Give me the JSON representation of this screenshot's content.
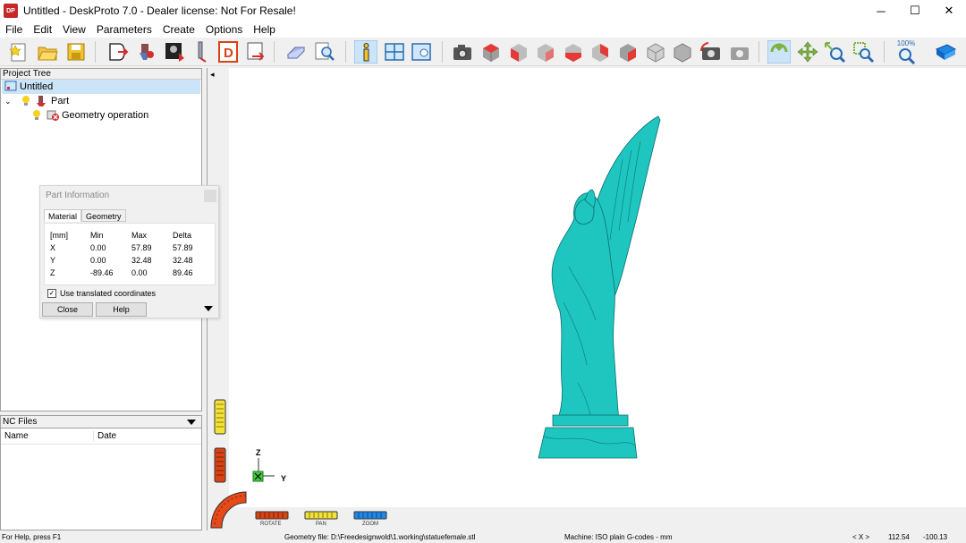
{
  "window": {
    "title": "Untitled - DeskProto 7.0 - Dealer license: Not For Resale!",
    "app_icon_label": "DP",
    "minimize": "─",
    "maximize": "☐",
    "close": "✕"
  },
  "menu": {
    "items": [
      {
        "label": "File"
      },
      {
        "label": "Edit"
      },
      {
        "label": "View"
      },
      {
        "label": "Parameters"
      },
      {
        "label": "Create"
      },
      {
        "label": "Options"
      },
      {
        "label": "Help"
      }
    ]
  },
  "toolbar": {
    "zoom_label": "100%"
  },
  "project_tree": {
    "header": "Project Tree",
    "root": "Untitled",
    "part": "Part",
    "operation": "Geometry operation"
  },
  "nc_files": {
    "header": "NC Files",
    "col_name": "Name",
    "col_date": "Date"
  },
  "part_info": {
    "title": "Part Information",
    "tabs": [
      {
        "label": "Material"
      },
      {
        "label": "Geometry"
      }
    ],
    "headers": [
      "[mm]",
      "Min",
      "Max",
      "Delta"
    ],
    "rows": [
      {
        "axis": "X",
        "min": "0.00",
        "max": "57.89",
        "delta": "57.89"
      },
      {
        "axis": "Y",
        "min": "0.00",
        "max": "32.48",
        "delta": "32.48"
      },
      {
        "axis": "Z",
        "min": "-89.46",
        "max": "0.00",
        "delta": "89.46"
      }
    ],
    "checkbox_label": "Use translated coordinates",
    "checkbox_mark": "✓",
    "close_button": "Close",
    "help_button": "Help"
  },
  "viewport": {
    "axis_z": "Z",
    "axis_y": "Y",
    "collapse_arrow": "◂",
    "rotate_label": "ROTATE",
    "pan_label": "PAN",
    "zoom_label": "ZOOM",
    "model_color": "#1fc6c0"
  },
  "status": {
    "help": "For Help, press F1",
    "geometry_file": "Geometry file: D:\\Freedesignwold\\1.working\\statuefemale.stl",
    "machine": "Machine: ISO plain G-codes - mm",
    "coord_label": "< X >",
    "x": "112.54",
    "y": "-100.13"
  }
}
